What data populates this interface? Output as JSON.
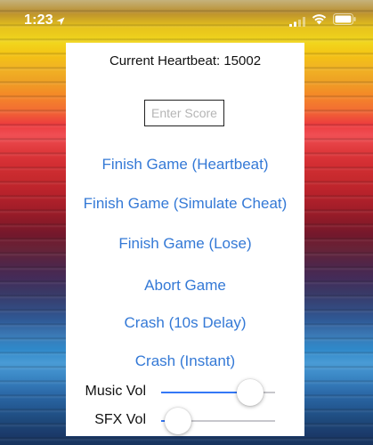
{
  "status_bar": {
    "time": "1:23",
    "icons": [
      "location-arrow-icon",
      "signal-icon",
      "wifi-icon",
      "battery-icon"
    ]
  },
  "panel": {
    "heartbeat_label": "Current Heartbeat:",
    "heartbeat_value": "15002",
    "score_placeholder": "Enter Score",
    "actions": [
      "Finish Game (Heartbeat)",
      "Finish Game (Simulate Cheat)",
      "Finish Game (Lose)",
      "Abort Game",
      "Crash (10s Delay)",
      "Crash (Instant)"
    ],
    "sliders": [
      {
        "label": "Music Vol",
        "value": 0.78
      },
      {
        "label": "SFX Vol",
        "value": 0.15
      }
    ]
  },
  "colors": {
    "link": "#3479d6",
    "slider_fill": "#3478f6",
    "slider_track": "#c7c7cc"
  }
}
